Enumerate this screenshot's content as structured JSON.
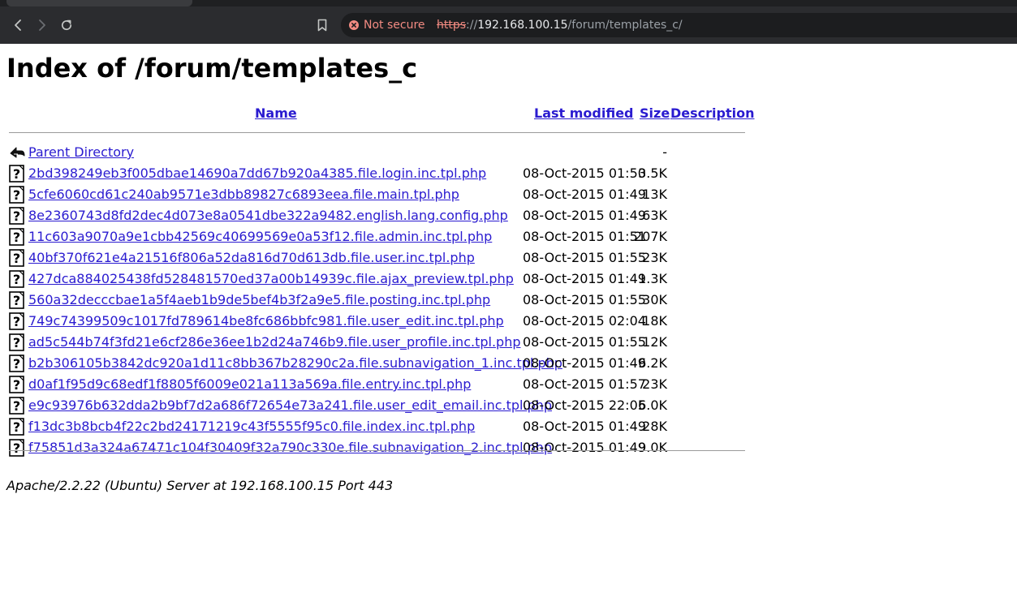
{
  "browser": {
    "security_label": "Not secure",
    "url_scheme": "https",
    "url_separator": "://",
    "url_host": "192.168.100.15",
    "url_path": "/forum/templates_c/",
    "security_color": "#f28b82",
    "icons": {
      "back": "back-arrow-icon",
      "forward": "forward-arrow-icon",
      "reload": "reload-icon",
      "bookmark": "bookmark-icon",
      "security": "not-secure-icon"
    }
  },
  "page": {
    "title": "Index of /forum/templates_c",
    "columns": {
      "name": "Name",
      "last_modified": "Last modified",
      "size": "Size",
      "description": "Description"
    },
    "parent": {
      "name": "Parent Directory",
      "size": "-"
    },
    "files": [
      {
        "name": "2bd398249eb3f005dbae14690a7dd67b920a4385.file.login.inc.tpl.php",
        "modified": "08-Oct-2015 01:50",
        "size": "3.5K"
      },
      {
        "name": "5cfe6060cd61c240ab9571e3dbb89827c6893eea.file.main.tpl.php",
        "modified": "08-Oct-2015 01:49",
        "size": "13K"
      },
      {
        "name": "8e2360743d8fd2dec4d073e8a0541dbe322a9482.english.lang.config.php",
        "modified": "08-Oct-2015 01:49",
        "size": "63K"
      },
      {
        "name": "11c603a9070a9e1cbb42569c40699569e0a53f12.file.admin.inc.tpl.php",
        "modified": "08-Oct-2015 01:51",
        "size": "207K"
      },
      {
        "name": "40bf370f621e4a21516f806a52da816d70d613db.file.user.inc.tpl.php",
        "modified": "08-Oct-2015 01:55",
        "size": "23K"
      },
      {
        "name": "427dca884025438fd528481570ed37a00b14939c.file.ajax_preview.tpl.php",
        "modified": "08-Oct-2015 01:49",
        "size": "1.3K"
      },
      {
        "name": "560a32decccbae1a5f4aeb1b9de5bef4b3f2a9e5.file.posting.inc.tpl.php",
        "modified": "08-Oct-2015 01:55",
        "size": "30K"
      },
      {
        "name": "749c74399509c1017fd789614be8fc686bbfc981.file.user_edit.inc.tpl.php",
        "modified": "08-Oct-2015 02:04",
        "size": "18K"
      },
      {
        "name": "ad5c544b74f3fd21e6cf286e36ee1b2d24a746b9.file.user_profile.inc.tpl.php",
        "modified": "08-Oct-2015 01:55",
        "size": "12K"
      },
      {
        "name": "b2b306105b3842dc920a1d11c8bb367b28290c2a.file.subnavigation_1.inc.tpl.php",
        "modified": "08-Oct-2015 01:49",
        "size": "6.2K"
      },
      {
        "name": "d0af1f95d9c68edf1f8805f6009e021a113a569a.file.entry.inc.tpl.php",
        "modified": "08-Oct-2015 01:57",
        "size": "23K"
      },
      {
        "name": "e9c93976b632dda2b9bf7d2a686f72654e73a241.file.user_edit_email.inc.tpl.php",
        "modified": "08-Oct-2015 22:05",
        "size": "6.0K"
      },
      {
        "name": "f13dc3b8bcb4f22c2bd24171219c43f5555f95c0.file.index.inc.tpl.php",
        "modified": "08-Oct-2015 01:49",
        "size": "28K"
      },
      {
        "name": "f75851d3a324a67471c104f30409f32a790c330e.file.subnavigation_2.inc.tpl.php",
        "modified": "08-Oct-2015 01:49",
        "size": "9.0K"
      }
    ],
    "row_icons": {
      "parent": "parent-directory-icon",
      "file": "unknown-file-icon"
    },
    "footer": "Apache/2.2.22 (Ubuntu) Server at 192.168.100.15 Port 443"
  }
}
